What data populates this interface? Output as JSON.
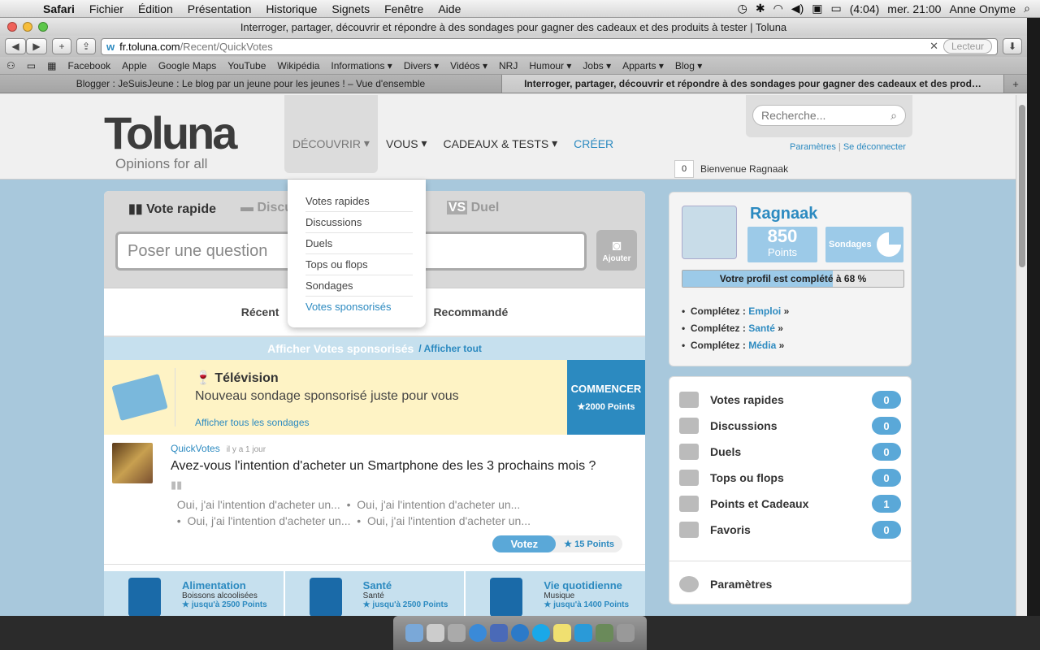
{
  "menubar": {
    "apple": "",
    "app": "Safari",
    "items": [
      "Fichier",
      "Édition",
      "Présentation",
      "Historique",
      "Signets",
      "Fenêtre",
      "Aide"
    ],
    "battery": "(4:04)",
    "clock": "mer. 21:00",
    "user": "Anne Onyme"
  },
  "window": {
    "title": "Interroger, partager, découvrir et répondre à des sondages pour gagner des cadeaux et des produits à tester | Toluna"
  },
  "address": {
    "domain": "fr.toluna.com",
    "path": "/Recent/QuickVotes",
    "reader": "Lecteur"
  },
  "bookmarks": [
    "Facebook",
    "Apple",
    "Google Maps",
    "YouTube",
    "Wikipédia",
    "Informations ▾",
    "Divers ▾",
    "Vidéos ▾",
    "NRJ",
    "Humour ▾",
    "Jobs ▾",
    "Apparts ▾",
    "Blog ▾"
  ],
  "tabs": [
    {
      "label": "Blogger : JeSuisJeune : Le blog par un jeune pour les jeunes ! – Vue d'ensemble"
    },
    {
      "label": "Interroger, partager, découvrir et répondre à des sondages pour gagner des cadeaux et des prod…"
    }
  ],
  "site": {
    "logo": "Toluna",
    "tagline": "Opinions for all",
    "nav": [
      "DÉCOUVRIR",
      "VOUS",
      "CADEAUX & TESTS",
      "CRÉER"
    ],
    "search_placeholder": "Recherche...",
    "links": {
      "settings": "Paramètres",
      "sep": "|",
      "logout": "Se déconnecter"
    },
    "welcome": {
      "count": "0",
      "text": "Bienvenue Ragnaak"
    },
    "dropdown": [
      "Votes rapides",
      "Discussions",
      "Duels",
      "Tops ou flops",
      "Sondages",
      "Votes sponsorisés"
    ],
    "ask": {
      "tab_selected": "Vote rapide",
      "tab_discuss": "Discu",
      "tab_duel": "Duel",
      "tab_duel_prefix": "VS",
      "tab_hidden": "o",
      "placeholder": "Poser une question",
      "camera": "Ajouter"
    },
    "subtabs": [
      "Récent",
      "Recommandé"
    ],
    "sponsored": {
      "title": "Afficher Votes sponsorisés",
      "all": "/ Afficher tout"
    },
    "tv": {
      "title": "Télévision",
      "subtitle": "Nouveau sondage sponsorisé juste pour vous",
      "link": "Afficher tous les sondages",
      "cta": "COMMENCER",
      "points": "★2000 Points"
    },
    "poll": {
      "source": "QuickVotes",
      "time": "il y a 1 jour",
      "question": "Avez-vous l'intention d'acheter un Smartphone des les 3 prochains mois ?",
      "options": [
        "Oui, j'ai l'intention d'acheter un...",
        "Oui, j'ai l'intention d'acheter un...",
        "Oui, j'ai l'intention d'acheter un...",
        "Oui, j'ai l'intention d'acheter un..."
      ],
      "vote": "Votez",
      "points": "★ 15 Points"
    },
    "categories": [
      {
        "title": "Alimentation",
        "sub": "Boissons alcoolisées",
        "pts": "★ jusqu'à 2500 Points"
      },
      {
        "title": "Santé",
        "sub": "Santé",
        "pts": "★ jusqu'à 2500 Points"
      },
      {
        "title": "Vie quotidienne",
        "sub": "Musique",
        "pts": "★ jusqu'à 1400 Points"
      }
    ],
    "profile": {
      "name": "Ragnaak",
      "points": "850",
      "points_label": "Points",
      "surveys": "Sondages",
      "progress_label": "Votre profil est complété à 68 %",
      "progress": 0.68,
      "complete": [
        {
          "label": "Complétez :",
          "link": "Emploi"
        },
        {
          "label": "Complétez :",
          "link": "Santé"
        },
        {
          "label": "Complétez :",
          "link": "Média"
        }
      ]
    },
    "activity": [
      {
        "label": "Votes rapides",
        "count": "0"
      },
      {
        "label": "Discussions",
        "count": "0"
      },
      {
        "label": "Duels",
        "count": "0"
      },
      {
        "label": "Tops ou flops",
        "count": "0"
      },
      {
        "label": "Points et Cadeaux",
        "count": "1"
      },
      {
        "label": "Favoris",
        "count": "0"
      }
    ],
    "settings": "Paramètres"
  }
}
